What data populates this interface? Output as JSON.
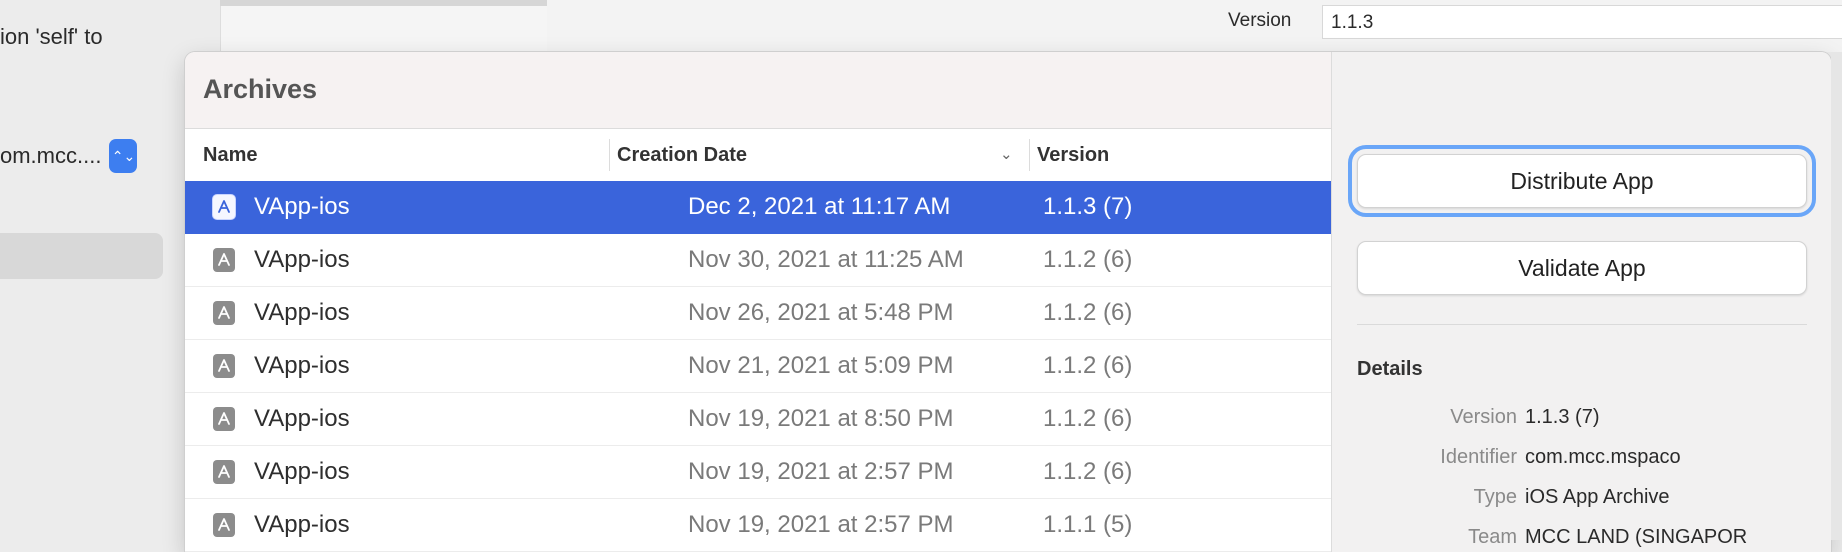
{
  "background": {
    "left_text": "ion 'self' to",
    "left_select_text": "om.mcc....",
    "stepper_glyph": "⌃⌄",
    "version_label": "Version",
    "version_value": "1.1.3"
  },
  "sheet": {
    "title": "Archives",
    "columns": {
      "name": "Name",
      "creation_date": "Creation Date",
      "version": "Version"
    },
    "sort_indicator": "⌄",
    "rows": [
      {
        "name": "VApp-ios",
        "date": "Dec 2, 2021 at 11:17 AM",
        "version": "1.1.3 (7)",
        "selected": true
      },
      {
        "name": "VApp-ios",
        "date": "Nov 30, 2021 at 11:25 AM",
        "version": "1.1.2 (6)",
        "selected": false
      },
      {
        "name": "VApp-ios",
        "date": "Nov 26, 2021 at 5:48 PM",
        "version": "1.1.2 (6)",
        "selected": false
      },
      {
        "name": "VApp-ios",
        "date": "Nov 21, 2021 at 5:09 PM",
        "version": "1.1.2 (6)",
        "selected": false
      },
      {
        "name": "VApp-ios",
        "date": "Nov 19, 2021 at 8:50 PM",
        "version": "1.1.2 (6)",
        "selected": false
      },
      {
        "name": "VApp-ios",
        "date": "Nov 19, 2021 at 2:57 PM",
        "version": "1.1.2 (6)",
        "selected": false
      },
      {
        "name": "VApp-ios",
        "date": "Nov 19, 2021 at 2:57 PM",
        "version": "1.1.1 (5)",
        "selected": false
      }
    ],
    "actions": {
      "distribute": "Distribute App",
      "validate": "Validate App"
    },
    "details": {
      "title": "Details",
      "items": [
        {
          "label": "Version",
          "value": "1.1.3 (7)"
        },
        {
          "label": "Identifier",
          "value": "com.mcc.mspaco"
        },
        {
          "label": "Type",
          "value": "iOS App Archive"
        },
        {
          "label": "Team",
          "value": "MCC LAND (SINGAPOR"
        }
      ]
    }
  },
  "colors": {
    "selection": "#3a64db",
    "focus_ring": "#6aa6f8",
    "stepper": "#3d7ef0"
  }
}
